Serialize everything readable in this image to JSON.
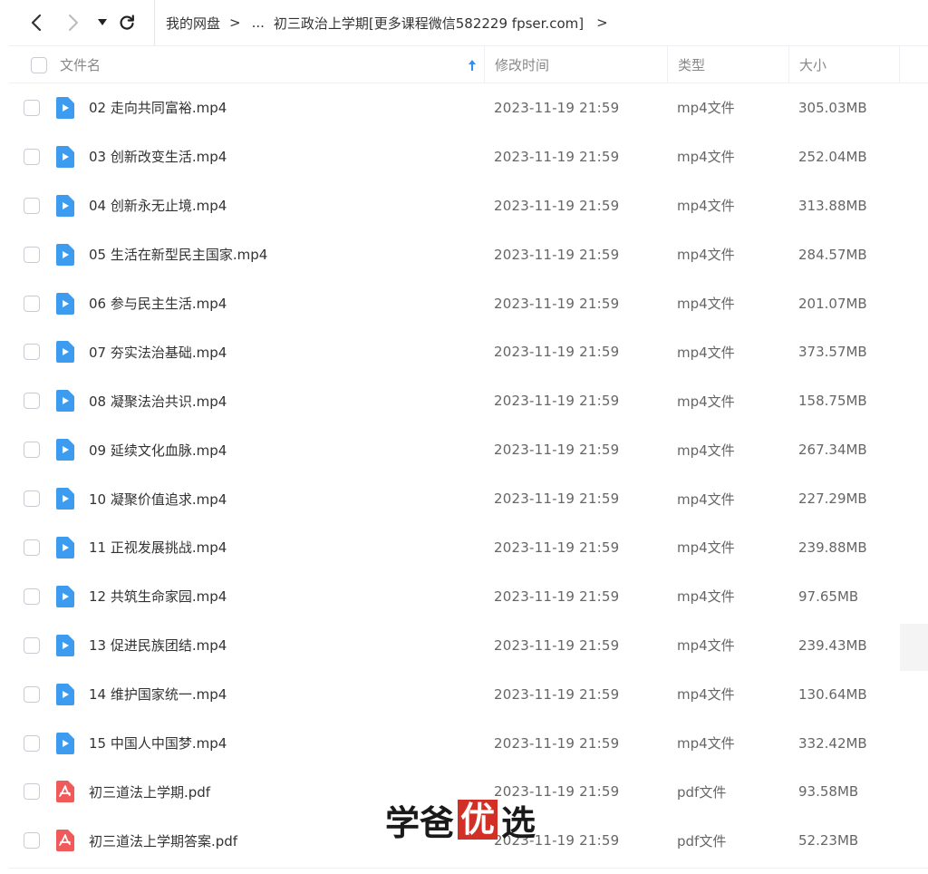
{
  "nav": {
    "back_icon": "chevron-left-icon",
    "forward_icon": "chevron-right-icon",
    "history_icon": "caret-down-icon",
    "refresh_icon": "refresh-icon"
  },
  "breadcrumb": {
    "root": "我的网盘",
    "separator": ">",
    "ellipsis": "...",
    "current": "初三政治上学期[更多课程微信582229 fpser.com]",
    "trailing": ">"
  },
  "table": {
    "columns": {
      "name": "文件名",
      "modified": "修改时间",
      "type": "类型",
      "size": "大小"
    },
    "sort_icon": "arrow-up-icon",
    "rows": [
      {
        "name": "02 走向共同富裕.mp4",
        "modified": "2023-11-19 21:59",
        "type": "mp4文件",
        "size": "305.03MB",
        "icon": "video"
      },
      {
        "name": "03 创新改变生活.mp4",
        "modified": "2023-11-19 21:59",
        "type": "mp4文件",
        "size": "252.04MB",
        "icon": "video"
      },
      {
        "name": "04 创新永无止境.mp4",
        "modified": "2023-11-19 21:59",
        "type": "mp4文件",
        "size": "313.88MB",
        "icon": "video"
      },
      {
        "name": "05 生活在新型民主国家.mp4",
        "modified": "2023-11-19 21:59",
        "type": "mp4文件",
        "size": "284.57MB",
        "icon": "video"
      },
      {
        "name": "06 参与民主生活.mp4",
        "modified": "2023-11-19 21:59",
        "type": "mp4文件",
        "size": "201.07MB",
        "icon": "video"
      },
      {
        "name": "07 夯实法治基础.mp4",
        "modified": "2023-11-19 21:59",
        "type": "mp4文件",
        "size": "373.57MB",
        "icon": "video"
      },
      {
        "name": "08 凝聚法治共识.mp4",
        "modified": "2023-11-19 21:59",
        "type": "mp4文件",
        "size": "158.75MB",
        "icon": "video"
      },
      {
        "name": "09 延续文化血脉.mp4",
        "modified": "2023-11-19 21:59",
        "type": "mp4文件",
        "size": "267.34MB",
        "icon": "video"
      },
      {
        "name": "10 凝聚价值追求.mp4",
        "modified": "2023-11-19 21:59",
        "type": "mp4文件",
        "size": "227.29MB",
        "icon": "video"
      },
      {
        "name": "11 正视发展挑战.mp4",
        "modified": "2023-11-19 21:59",
        "type": "mp4文件",
        "size": "239.88MB",
        "icon": "video"
      },
      {
        "name": "12 共筑生命家园.mp4",
        "modified": "2023-11-19 21:59",
        "type": "mp4文件",
        "size": "97.65MB",
        "icon": "video"
      },
      {
        "name": "13 促进民族团结.mp4",
        "modified": "2023-11-19 21:59",
        "type": "mp4文件",
        "size": "239.43MB",
        "icon": "video"
      },
      {
        "name": "14 维护国家统一.mp4",
        "modified": "2023-11-19 21:59",
        "type": "mp4文件",
        "size": "130.64MB",
        "icon": "video"
      },
      {
        "name": "15 中国人中国梦.mp4",
        "modified": "2023-11-19 21:59",
        "type": "mp4文件",
        "size": "332.42MB",
        "icon": "video"
      },
      {
        "name": "初三道法上学期.pdf",
        "modified": "2023-11-19 21:59",
        "type": "pdf文件",
        "size": "93.58MB",
        "icon": "pdf"
      },
      {
        "name": "初三道法上学期答案.pdf",
        "modified": "2023-11-19 21:59",
        "type": "pdf文件",
        "size": "52.23MB",
        "icon": "pdf"
      }
    ]
  },
  "watermark": {
    "part1": "学爸",
    "part2": "优",
    "part3": "选"
  },
  "colors": {
    "video_icon": "#3d9cf0",
    "pdf_icon": "#f05a5a",
    "sort_arrow": "#2f8ff0",
    "watermark_box": "#d22f26"
  }
}
